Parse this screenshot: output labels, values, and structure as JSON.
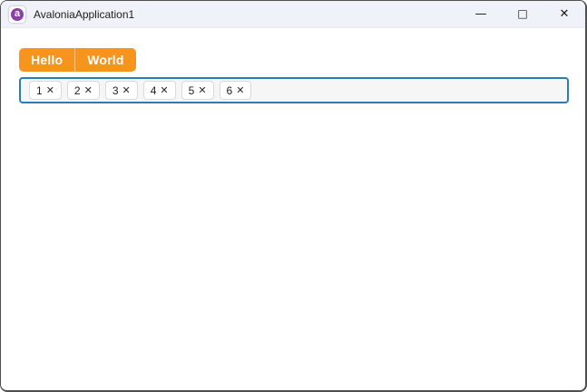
{
  "window": {
    "title": "AvaloniaApplication1",
    "app_icon": "avalonia-logo",
    "app_icon_glyph": "a",
    "controls": {
      "minimize_glyph": "—",
      "maximize_glyph": "□",
      "close_glyph": "✕"
    }
  },
  "tabs": [
    {
      "label": "Hello"
    },
    {
      "label": "World"
    }
  ],
  "tagsbox": {
    "items": [
      "1",
      "2",
      "3",
      "4",
      "5",
      "6"
    ],
    "remove_glyph": "✕"
  },
  "colors": {
    "titlebar-bg": "#eff2f8",
    "window-border": "#4f4f4f",
    "tab-orange": "#F7941E",
    "tagsbox-border": "#2B7BB9",
    "tagsbox-bg": "#f6f6f6",
    "tag-border": "#d9d9d9",
    "text-dark": "#1d1d1d",
    "avalonia-purple": "#8b3fa8"
  }
}
